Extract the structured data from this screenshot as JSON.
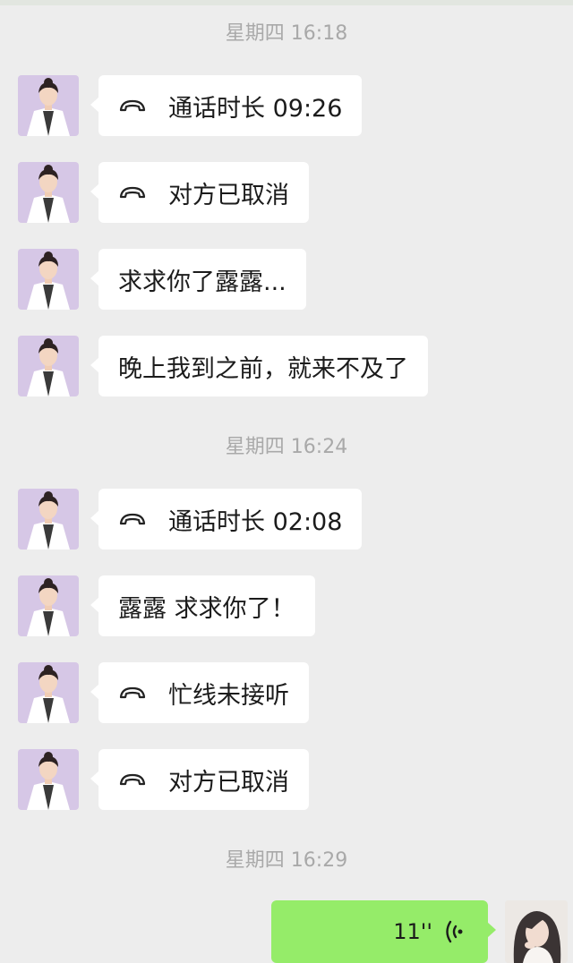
{
  "timestamps": [
    "星期四 16:18",
    "星期四 16:24",
    "星期四 16:29"
  ],
  "messages": [
    {
      "text": "通话时长 09:26",
      "icon": "phone-hangup-icon"
    },
    {
      "text": "对方已取消",
      "icon": "phone-hangup-icon"
    },
    {
      "text": "求求你了露露..."
    },
    {
      "text": "晚上我到之前，就来不及了"
    },
    {
      "text": "通话时长 02:08",
      "icon": "phone-hangup-icon"
    },
    {
      "text": "露露 求求你了！"
    },
    {
      "text": "忙线未接听",
      "icon": "phone-hangup-icon"
    },
    {
      "text": "对方已取消",
      "icon": "phone-hangup-icon"
    }
  ],
  "voice_message": {
    "duration": "11''",
    "icon": "voice-wave-icon"
  },
  "colors": {
    "background": "#ededed",
    "incoming_bubble": "#ffffff",
    "outgoing_bubble": "#95ec69",
    "timestamp": "#a9a9a9"
  }
}
